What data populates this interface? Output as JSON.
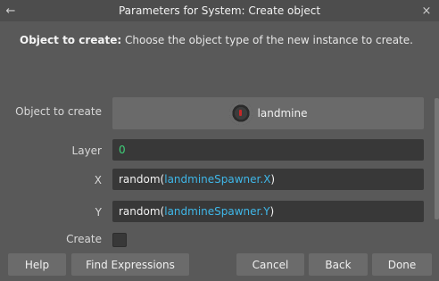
{
  "window": {
    "title": "Parameters for System: Create object",
    "back_glyph": "←",
    "close_glyph": "×"
  },
  "description": {
    "label": "Object to create:",
    "text": " Choose the object type of the new instance to create."
  },
  "params": {
    "object": {
      "label": "Object to create",
      "value": "landmine",
      "icon": "landmine-icon"
    },
    "layer": {
      "label": "Layer",
      "value": "0"
    },
    "x": {
      "label": "X",
      "fn": "random(",
      "arg": "landmineSpawner.X",
      "close": ")"
    },
    "y": {
      "label": "Y",
      "fn": "random(",
      "arg": "landmineSpawner.Y",
      "close": ")"
    },
    "create": {
      "label": "Create",
      "checked": false
    }
  },
  "buttons": {
    "help": "Help",
    "find_expressions": "Find Expressions",
    "cancel": "Cancel",
    "back": "Back",
    "done": "Done"
  },
  "colors": {
    "background": "#595959",
    "field": "#383838",
    "number": "#3fd27a",
    "object_ref": "#3fb7e8"
  }
}
